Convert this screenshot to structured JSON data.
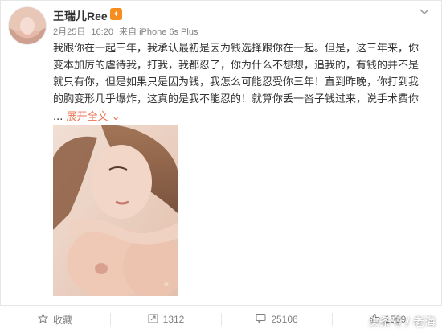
{
  "post": {
    "username": "王瑞儿Ree",
    "date": "2月25日",
    "time": "16:20",
    "source": "来自 iPhone 6s Plus",
    "text_lines": [
      "我跟你在一起三年，我承认最初是因为钱选择跟你在一起。但是，这三年来，你",
      "变本加厉的虐待我，打我，我都忍了，你为什么不想想，追我的，有钱的并不是",
      "就只有你，但是如果只是因为钱，我怎么可能忍受你三年！直到昨晚，你打到我",
      "的胸变形几乎爆炸，这真的是我不能忍的！就算你丢一沓子钱过来，说手术费你"
    ],
    "ellipsis": "...",
    "expand_label": "展开全文",
    "expand_arrow": "⌄"
  },
  "toolbar": {
    "favorite_label": "收藏",
    "repost_count": "1312",
    "comment_count": "25106",
    "like_count": "1509"
  },
  "watermark": {
    "site_text": "头条号 / 老海"
  },
  "icons": {
    "vip": "vip-badge-icon",
    "chevron": "chevron-down-icon",
    "favorite": "star-icon",
    "repost": "repost-icon",
    "comment": "comment-icon",
    "like": "thumbs-up-icon"
  },
  "colors": {
    "link": "#eb7350",
    "meta": "#808080",
    "badge": "#f78c1f"
  }
}
